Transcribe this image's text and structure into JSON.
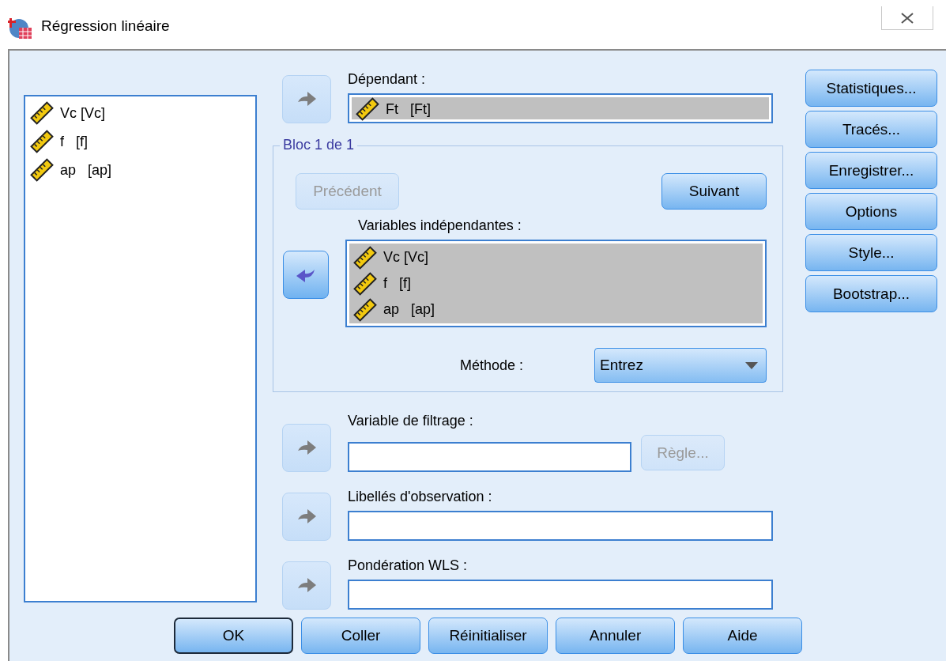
{
  "window": {
    "title": "Régression linéaire"
  },
  "source_variables": [
    {
      "label": "Vc [Vc]"
    },
    {
      "label": "f   [f]"
    },
    {
      "label": "ap   [ap]"
    }
  ],
  "dependent": {
    "label": "Dépendant :",
    "arrow": {
      "kind": "right",
      "disabled": true
    },
    "variables": [
      {
        "label": "Ft   [Ft]"
      }
    ]
  },
  "block": {
    "title": "Bloc 1 de 1",
    "previous": {
      "label": "Précédent",
      "disabled": true
    },
    "next": {
      "label": "Suivant",
      "disabled": false
    },
    "independent": {
      "label": "Variables indépendantes :",
      "arrow": {
        "kind": "left",
        "disabled": false
      },
      "variables": [
        {
          "label": "Vc [Vc]"
        },
        {
          "label": "f   [f]"
        },
        {
          "label": "ap   [ap]"
        }
      ]
    },
    "method": {
      "label": "Méthode :",
      "value": "Entrez"
    }
  },
  "fields": [
    {
      "label": "Variable de filtrage :",
      "arrow": {
        "kind": "right",
        "disabled": true
      },
      "rule_button": {
        "label": "Règle...",
        "disabled": true
      }
    },
    {
      "label": "Libellés d'observation :",
      "arrow": {
        "kind": "right",
        "disabled": true
      }
    },
    {
      "label": "Pondération WLS :",
      "arrow": {
        "kind": "right",
        "disabled": true
      }
    }
  ],
  "side_buttons": [
    {
      "label": "Statistiques..."
    },
    {
      "label": "Tracés..."
    },
    {
      "label": "Enregistrer..."
    },
    {
      "label": "Options"
    },
    {
      "label": "Style..."
    },
    {
      "label": "Bootstrap..."
    }
  ],
  "footer_buttons": [
    {
      "label": "OK",
      "default": true
    },
    {
      "label": "Coller",
      "default": false
    },
    {
      "label": "Réinitialiser",
      "default": false
    },
    {
      "label": "Annuler",
      "default": false
    },
    {
      "label": "Aide",
      "default": false
    }
  ]
}
